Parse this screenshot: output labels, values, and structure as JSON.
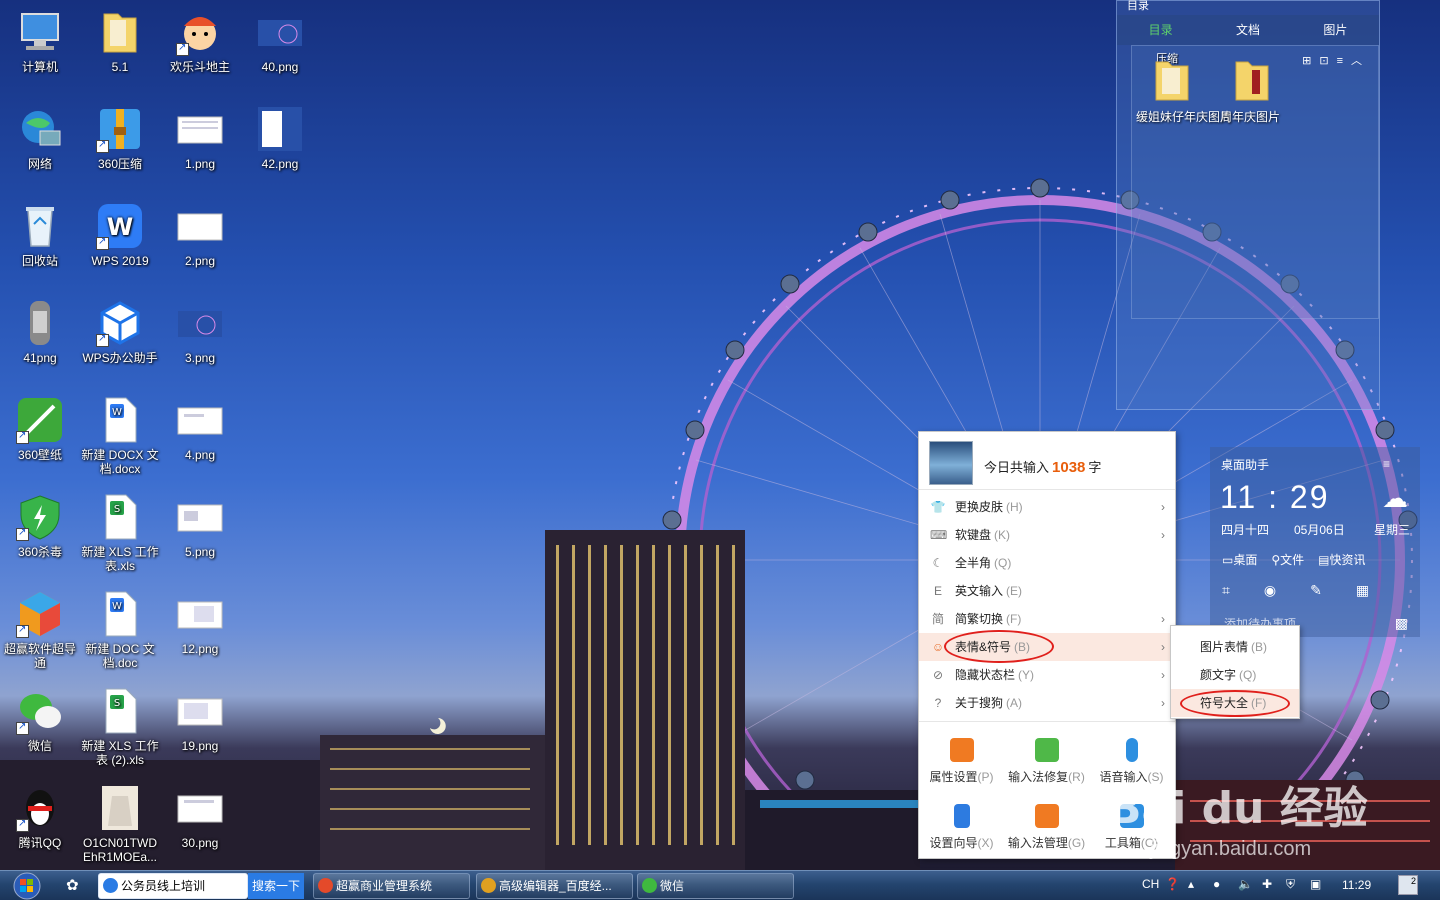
{
  "desktop_icons": [
    {
      "label": "计算机"
    },
    {
      "label": "5.1"
    },
    {
      "label": "欢乐斗地主"
    },
    {
      "label": "40.png"
    },
    {
      "label": "网络"
    },
    {
      "label": "360压缩"
    },
    {
      "label": "1.png"
    },
    {
      "label": "42.png"
    },
    {
      "label": "回收站"
    },
    {
      "label": "WPS 2019"
    },
    {
      "label": "2.png"
    },
    {
      "label": "41png"
    },
    {
      "label": "WPS办公助手"
    },
    {
      "label": "3.png"
    },
    {
      "label": "360壁纸"
    },
    {
      "label": "新建 DOCX 文档.docx"
    },
    {
      "label": "4.png"
    },
    {
      "label": "360杀毒"
    },
    {
      "label": "新建 XLS 工作表.xls"
    },
    {
      "label": "5.png"
    },
    {
      "label": "超赢软件超导通"
    },
    {
      "label": "新建 DOC 文档.doc"
    },
    {
      "label": "12.png"
    },
    {
      "label": "微信"
    },
    {
      "label": "新建 XLS 工作表 (2).xls"
    },
    {
      "label": "19.png"
    },
    {
      "label": "腾讯QQ"
    },
    {
      "label": "O1CN01TWD EhR1MOEa..."
    },
    {
      "label": "30.png"
    }
  ],
  "folder_widget": {
    "header": "目录",
    "tabs": [
      "目录",
      "文档",
      "图片"
    ],
    "section": "压缩",
    "folders": [
      "缓姐妹仔年庆图片",
      "周年庆图片"
    ]
  },
  "helper": {
    "title": "桌面助手",
    "time": "11 : 29",
    "lunar": "四月十四",
    "date": "05月06日",
    "weekday": "星期三",
    "links": [
      "桌面",
      "文件",
      "快资讯"
    ],
    "todo": "添加待办事项"
  },
  "sogou_menu": {
    "today_prefix": "今日共输入",
    "today_count": "1038",
    "today_unit": "字",
    "items": [
      {
        "label": "更换皮肤",
        "key": "(H)",
        "icon": "shirt-icon",
        "arrow": true
      },
      {
        "label": "软键盘",
        "key": "(K)",
        "icon": "keyboard-icon",
        "arrow": true
      },
      {
        "label": "全半角",
        "key": "(Q)",
        "icon": "moon-icon",
        "arrow": false
      },
      {
        "label": "英文输入",
        "key": "(E)",
        "icon": "english-icon",
        "arrow": false
      },
      {
        "label": "简繁切换",
        "key": "(F)",
        "icon": "jian-icon",
        "arrow": true
      },
      {
        "label": "表情&符号",
        "key": "(B)",
        "icon": "smile-icon",
        "arrow": true
      },
      {
        "label": "隐藏状态栏",
        "key": "(Y)",
        "icon": "hide-icon",
        "arrow": true
      },
      {
        "label": "关于搜狗",
        "key": "(A)",
        "icon": "question-icon",
        "arrow": true
      }
    ],
    "grid": [
      {
        "label": "属性设置",
        "key": "(P)",
        "color": "#f07a22"
      },
      {
        "label": "输入法修复",
        "key": "(R)",
        "color": "#4fb848"
      },
      {
        "label": "语音输入",
        "key": "(S)",
        "color": "#2d8fe0"
      },
      {
        "label": "设置向导",
        "key": "(X)",
        "color": "#2d7be0"
      },
      {
        "label": "输入法管理",
        "key": "(G)",
        "color": "#f07a22"
      },
      {
        "label": "工具箱",
        "key": "(O)",
        "color": "#2d8fe0"
      }
    ]
  },
  "submenu": {
    "items": [
      {
        "label": "图片表情",
        "key": "(B)"
      },
      {
        "label": "颜文字",
        "key": "(Q)"
      },
      {
        "label": "符号大全",
        "key": "(F)"
      }
    ]
  },
  "watermark": {
    "brand": "Bai du 经验",
    "url": "jingyan.baidu.com"
  },
  "taskbar": {
    "buttons": [
      {
        "label": "公务员线上培训",
        "color": "#2a7be4"
      },
      {
        "label": "超赢商业管理系统",
        "color": "#e44a2a"
      },
      {
        "label": "高级编辑器_百度经...",
        "color": "#e0a020"
      },
      {
        "label": "微信",
        "color": "#3fb93f"
      }
    ],
    "search": "搜索一下",
    "ime": "CH",
    "clock": "11:29",
    "notif_count": "2"
  }
}
